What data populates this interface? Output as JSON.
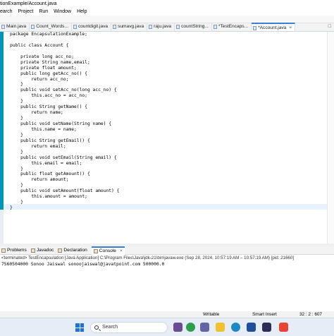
{
  "window": {
    "title": "tionExample/Account.java"
  },
  "menu": [
    "earch",
    "Project",
    "Run",
    "Window",
    "Help"
  ],
  "tabs": [
    {
      "label": "Main.java",
      "active": false
    },
    {
      "label": "Count_Words...",
      "active": false
    },
    {
      "label": "countdigit.java",
      "active": false
    },
    {
      "label": "sumavg.java",
      "active": false
    },
    {
      "label": "raju.java",
      "active": false
    },
    {
      "label": "countString...",
      "active": false
    },
    {
      "label": "*TestEncaps...",
      "active": false
    },
    {
      "label": "*Account.java",
      "active": true
    }
  ],
  "tab_close": "×",
  "tab_minmax": "□",
  "code_lines": [
    "package EncapsulationExample;",
    "",
    "public class Account {",
    "",
    "    private long acc_no;",
    "    private String name,email;",
    "    private float amount;",
    "    public long getAcc_no() {",
    "        return acc_no;",
    "    }",
    "    public void setAcc_no(long acc_no) {",
    "        this.acc_no = acc_no;",
    "    }",
    "    public String getName() {",
    "        return name;",
    "    }",
    "    public void setName(String name) {",
    "        this.name = name;",
    "    }",
    "    public String getEmail() {",
    "        return email;",
    "    }",
    "    public void setEmail(String email) {",
    "        this.email = email;",
    "    }",
    "    public float getAmount() {",
    "        return amount;",
    "    }",
    "    public void setAmount(float amount) {",
    "        this.amount = amount;",
    "    }",
    "}"
  ],
  "console_tabs": [
    {
      "label": "Problems",
      "active": false
    },
    {
      "label": "Javadoc",
      "active": false
    },
    {
      "label": "Declaration",
      "active": false
    },
    {
      "label": "Console",
      "active": true
    }
  ],
  "console": {
    "terminated": "<terminated> TestEncapsulation [Java Application] C:\\Program Files\\Java\\jdk-21\\bin\\javaw.exe (Sep 28, 2024, 10:57:19 AM – 10:57:19 AM) [pid: 21660]",
    "output": "7560504000 Sonoo Jaiswal sonoojaiswal@javatpoint.com 500000.0"
  },
  "status": {
    "mode": "Writable",
    "insert": "Smart Insert",
    "position": "32 : 2 : 607"
  },
  "taskbar": {
    "search_placeholder": "Search"
  }
}
